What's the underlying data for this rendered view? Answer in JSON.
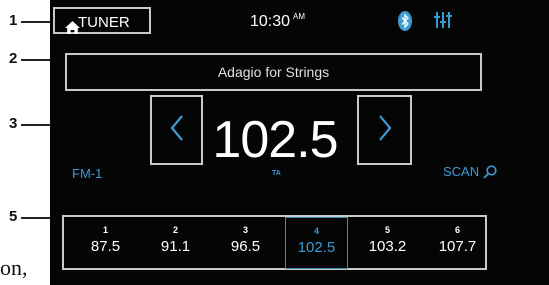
{
  "callouts": [
    "1",
    "2",
    "3",
    "4",
    "5"
  ],
  "page_text_fragment": "on,",
  "header": {
    "source_label": "TUNER",
    "home_icon": "home-icon",
    "time": "10:30",
    "time_suffix": "AM",
    "bluetooth_icon": "bluetooth-icon",
    "equalizer_icon": "equalizer-sliders-icon"
  },
  "now_playing": {
    "title": "Adagio for Strings"
  },
  "tuner": {
    "frequency": "102.5",
    "ta_label": "TA",
    "band": "FM-1",
    "scan_label": "SCAN",
    "prev_icon": "chevron-left-icon",
    "next_icon": "chevron-right-icon"
  },
  "presets": [
    {
      "number": "1",
      "frequency": "87.5",
      "active": false
    },
    {
      "number": "2",
      "frequency": "91.1",
      "active": false
    },
    {
      "number": "3",
      "frequency": "96.5",
      "active": false
    },
    {
      "number": "4",
      "frequency": "102.5",
      "active": true
    },
    {
      "number": "5",
      "frequency": "103.2",
      "active": false
    },
    {
      "number": "6",
      "frequency": "107.7",
      "active": false
    }
  ],
  "colors": {
    "accent": "#3a9bd5",
    "background": "#050505",
    "outline": "#c9c9c9",
    "active_preset_border": "#3a8fb8"
  }
}
